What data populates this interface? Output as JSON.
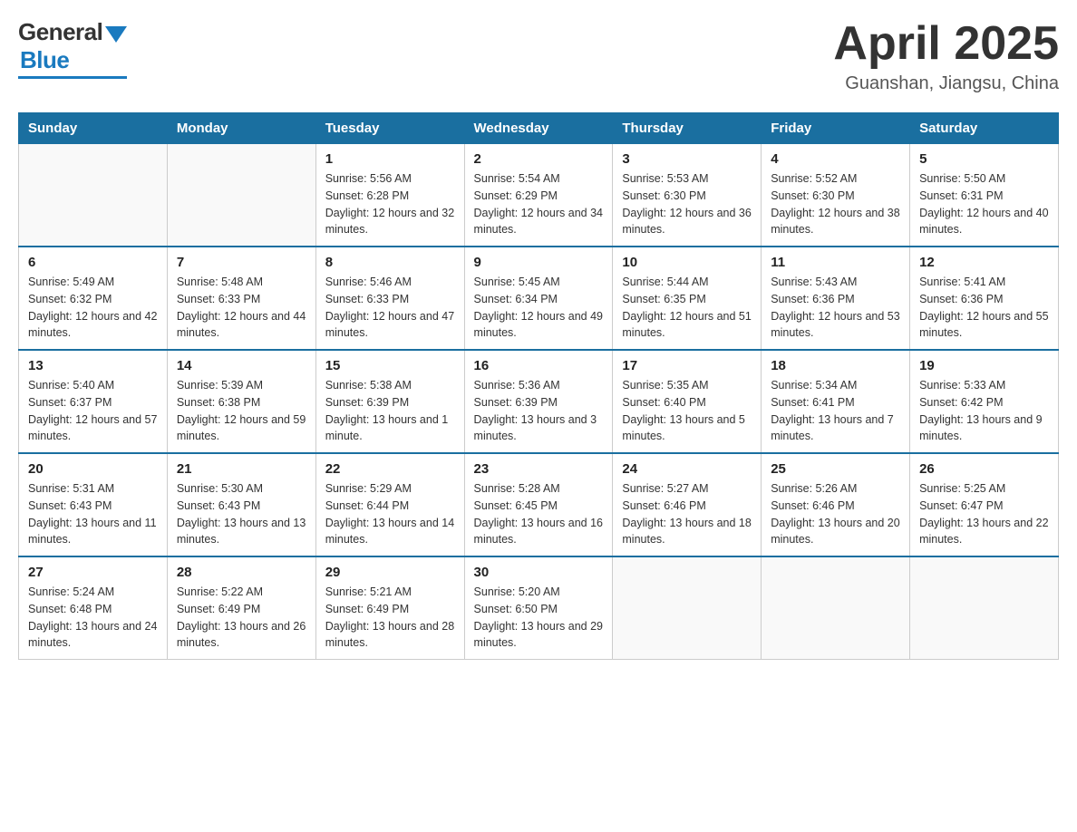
{
  "logo": {
    "general": "General",
    "blue": "Blue"
  },
  "title": "April 2025",
  "location": "Guanshan, Jiangsu, China",
  "days_of_week": [
    "Sunday",
    "Monday",
    "Tuesday",
    "Wednesday",
    "Thursday",
    "Friday",
    "Saturday"
  ],
  "weeks": [
    [
      {
        "day": "",
        "empty": true
      },
      {
        "day": "",
        "empty": true
      },
      {
        "day": "1",
        "sunrise": "5:56 AM",
        "sunset": "6:28 PM",
        "daylight": "12 hours and 32 minutes."
      },
      {
        "day": "2",
        "sunrise": "5:54 AM",
        "sunset": "6:29 PM",
        "daylight": "12 hours and 34 minutes."
      },
      {
        "day": "3",
        "sunrise": "5:53 AM",
        "sunset": "6:30 PM",
        "daylight": "12 hours and 36 minutes."
      },
      {
        "day": "4",
        "sunrise": "5:52 AM",
        "sunset": "6:30 PM",
        "daylight": "12 hours and 38 minutes."
      },
      {
        "day": "5",
        "sunrise": "5:50 AM",
        "sunset": "6:31 PM",
        "daylight": "12 hours and 40 minutes."
      }
    ],
    [
      {
        "day": "6",
        "sunrise": "5:49 AM",
        "sunset": "6:32 PM",
        "daylight": "12 hours and 42 minutes."
      },
      {
        "day": "7",
        "sunrise": "5:48 AM",
        "sunset": "6:33 PM",
        "daylight": "12 hours and 44 minutes."
      },
      {
        "day": "8",
        "sunrise": "5:46 AM",
        "sunset": "6:33 PM",
        "daylight": "12 hours and 47 minutes."
      },
      {
        "day": "9",
        "sunrise": "5:45 AM",
        "sunset": "6:34 PM",
        "daylight": "12 hours and 49 minutes."
      },
      {
        "day": "10",
        "sunrise": "5:44 AM",
        "sunset": "6:35 PM",
        "daylight": "12 hours and 51 minutes."
      },
      {
        "day": "11",
        "sunrise": "5:43 AM",
        "sunset": "6:36 PM",
        "daylight": "12 hours and 53 minutes."
      },
      {
        "day": "12",
        "sunrise": "5:41 AM",
        "sunset": "6:36 PM",
        "daylight": "12 hours and 55 minutes."
      }
    ],
    [
      {
        "day": "13",
        "sunrise": "5:40 AM",
        "sunset": "6:37 PM",
        "daylight": "12 hours and 57 minutes."
      },
      {
        "day": "14",
        "sunrise": "5:39 AM",
        "sunset": "6:38 PM",
        "daylight": "12 hours and 59 minutes."
      },
      {
        "day": "15",
        "sunrise": "5:38 AM",
        "sunset": "6:39 PM",
        "daylight": "13 hours and 1 minute."
      },
      {
        "day": "16",
        "sunrise": "5:36 AM",
        "sunset": "6:39 PM",
        "daylight": "13 hours and 3 minutes."
      },
      {
        "day": "17",
        "sunrise": "5:35 AM",
        "sunset": "6:40 PM",
        "daylight": "13 hours and 5 minutes."
      },
      {
        "day": "18",
        "sunrise": "5:34 AM",
        "sunset": "6:41 PM",
        "daylight": "13 hours and 7 minutes."
      },
      {
        "day": "19",
        "sunrise": "5:33 AM",
        "sunset": "6:42 PM",
        "daylight": "13 hours and 9 minutes."
      }
    ],
    [
      {
        "day": "20",
        "sunrise": "5:31 AM",
        "sunset": "6:43 PM",
        "daylight": "13 hours and 11 minutes."
      },
      {
        "day": "21",
        "sunrise": "5:30 AM",
        "sunset": "6:43 PM",
        "daylight": "13 hours and 13 minutes."
      },
      {
        "day": "22",
        "sunrise": "5:29 AM",
        "sunset": "6:44 PM",
        "daylight": "13 hours and 14 minutes."
      },
      {
        "day": "23",
        "sunrise": "5:28 AM",
        "sunset": "6:45 PM",
        "daylight": "13 hours and 16 minutes."
      },
      {
        "day": "24",
        "sunrise": "5:27 AM",
        "sunset": "6:46 PM",
        "daylight": "13 hours and 18 minutes."
      },
      {
        "day": "25",
        "sunrise": "5:26 AM",
        "sunset": "6:46 PM",
        "daylight": "13 hours and 20 minutes."
      },
      {
        "day": "26",
        "sunrise": "5:25 AM",
        "sunset": "6:47 PM",
        "daylight": "13 hours and 22 minutes."
      }
    ],
    [
      {
        "day": "27",
        "sunrise": "5:24 AM",
        "sunset": "6:48 PM",
        "daylight": "13 hours and 24 minutes."
      },
      {
        "day": "28",
        "sunrise": "5:22 AM",
        "sunset": "6:49 PM",
        "daylight": "13 hours and 26 minutes."
      },
      {
        "day": "29",
        "sunrise": "5:21 AM",
        "sunset": "6:49 PM",
        "daylight": "13 hours and 28 minutes."
      },
      {
        "day": "30",
        "sunrise": "5:20 AM",
        "sunset": "6:50 PM",
        "daylight": "13 hours and 29 minutes."
      },
      {
        "day": "",
        "empty": true
      },
      {
        "day": "",
        "empty": true
      },
      {
        "day": "",
        "empty": true
      }
    ]
  ]
}
